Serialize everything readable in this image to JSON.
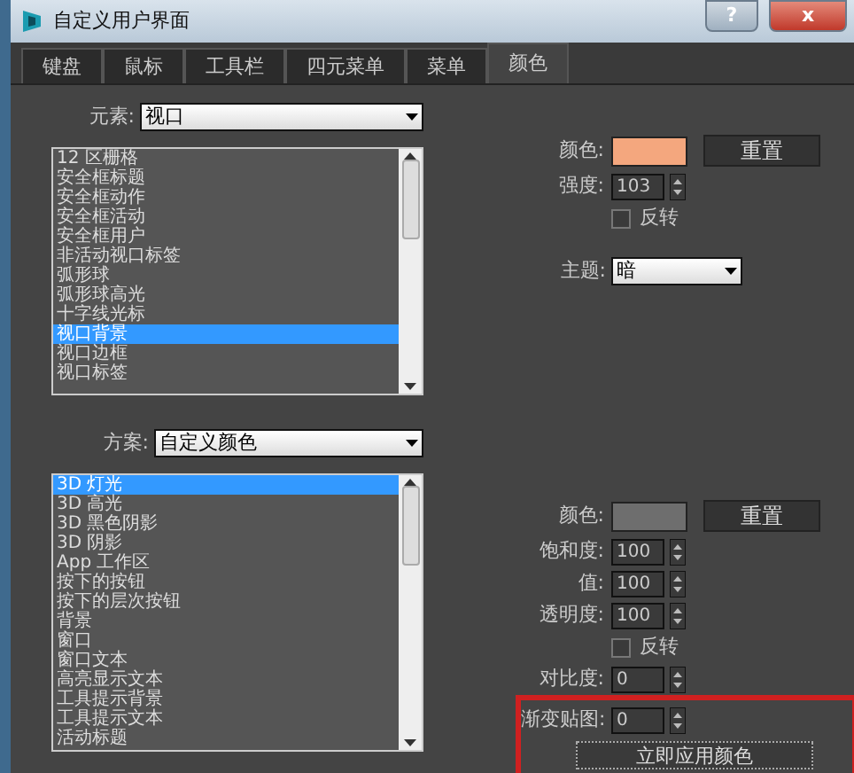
{
  "window": {
    "title": "自定义用户界面",
    "help": "?",
    "close": "x"
  },
  "tabs": [
    {
      "label": "键盘",
      "selected": false
    },
    {
      "label": "鼠标",
      "selected": false
    },
    {
      "label": "工具栏",
      "selected": false
    },
    {
      "label": "四元菜单",
      "selected": false
    },
    {
      "label": "菜单",
      "selected": false
    },
    {
      "label": "颜色",
      "selected": true
    }
  ],
  "element_section": {
    "label": "元素:",
    "value": "视口",
    "items": [
      {
        "label": "12 区栅格",
        "selected": false
      },
      {
        "label": "安全框标题",
        "selected": false
      },
      {
        "label": "安全框动作",
        "selected": false
      },
      {
        "label": "安全框活动",
        "selected": false
      },
      {
        "label": "安全框用户",
        "selected": false
      },
      {
        "label": "非活动视口标签",
        "selected": false
      },
      {
        "label": "弧形球",
        "selected": false
      },
      {
        "label": "弧形球高光",
        "selected": false
      },
      {
        "label": "十字线光标",
        "selected": false
      },
      {
        "label": "视口背景",
        "selected": true
      },
      {
        "label": "视口边框",
        "selected": false
      },
      {
        "label": "视口标签",
        "selected": false
      }
    ],
    "color_label": "颜色:",
    "color": "#f4a77e",
    "reset": "重置",
    "spinners": [
      {
        "label": "强度:",
        "value": "103"
      }
    ],
    "invert": {
      "label": "反转",
      "checked": false
    },
    "theme": {
      "label": "主题:",
      "value": "暗"
    }
  },
  "scheme_section": {
    "label": "方案:",
    "value": "自定义颜色",
    "items": [
      {
        "label": "3D 灯光",
        "selected": true
      },
      {
        "label": "3D 高光",
        "selected": false
      },
      {
        "label": "3D 黑色阴影",
        "selected": false
      },
      {
        "label": "3D 阴影",
        "selected": false
      },
      {
        "label": "App 工作区",
        "selected": false
      },
      {
        "label": "按下的按钮",
        "selected": false
      },
      {
        "label": "按下的层次按钮",
        "selected": false
      },
      {
        "label": "背景",
        "selected": false
      },
      {
        "label": "窗口",
        "selected": false
      },
      {
        "label": "窗口文本",
        "selected": false
      },
      {
        "label": "高亮显示文本",
        "selected": false
      },
      {
        "label": "工具提示背景",
        "selected": false
      },
      {
        "label": "工具提示文本",
        "selected": false
      },
      {
        "label": "活动标题",
        "selected": false
      }
    ],
    "color_label": "颜色:",
    "color": "#6e6e6e",
    "reset": "重置",
    "spinners": [
      {
        "label": "饱和度:",
        "value": "100"
      },
      {
        "label": "值:",
        "value": "100"
      },
      {
        "label": "透明度:",
        "value": "100"
      }
    ],
    "invert": {
      "label": "反转",
      "checked": false
    },
    "spinners_after": [
      {
        "label": "对比度:",
        "value": "0"
      },
      {
        "label": "渐变贴图:",
        "value": "0"
      }
    ],
    "apply": "立即应用颜色",
    "highlighted": true
  }
}
